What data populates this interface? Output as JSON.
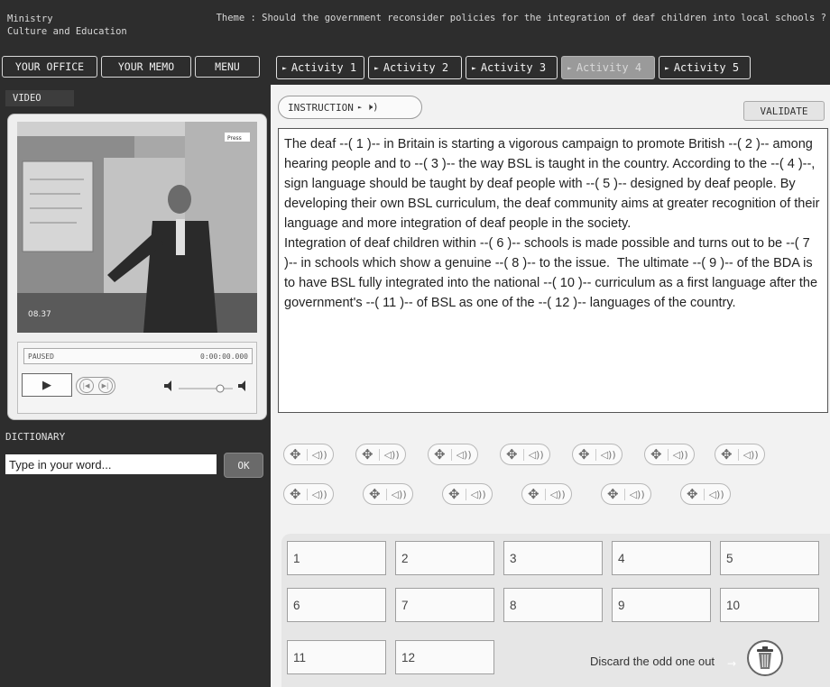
{
  "header": {
    "brand_line1": "Ministry",
    "brand_line2": "Culture and Education",
    "theme": "Theme : Should the government reconsider policies for the integration of deaf children into local schools ?"
  },
  "nav": {
    "office": "YOUR OFFICE",
    "memo": "YOUR MEMO",
    "menu": "MENU",
    "activities": [
      "Activity 1",
      "Activity 2",
      "Activity 3",
      "Activity 4",
      "Activity 5"
    ],
    "active_activity": "Activity 4"
  },
  "video": {
    "label": "VIDEO",
    "status": "PAUSED",
    "time": "0:00:00.000",
    "timestamp_overlay": "08.37",
    "corner_tag": "Press"
  },
  "dictionary": {
    "label": "DICTIONARY",
    "placeholder": "Type in your word...",
    "ok": "OK"
  },
  "main": {
    "instruction": "INSTRUCTION",
    "validate": "VALIDATE",
    "text": "The deaf --( 1 )-- in Britain is starting a vigorous campaign to promote British --( 2 )-- among hearing people and to --( 3 )-- the way BSL is taught in the country. According to the --( 4 )--, sign language should be taught by deaf people with --( 5 )-- designed by deaf people. By developing their own BSL curriculum, the deaf community aims at greater recognition of their language and more integration of deaf people in the society.\nIntegration of deaf children within --( 6 )-- schools is made possible and turns out to be --( 7 )-- in schools which show a genuine --( 8 )-- to the issue.  The ultimate --( 9 )-- of the BDA is to have BSL fully integrated into the national --( 10 )-- curriculum as a first language after the government's --( 11 )-- of BSL as one of the --( 12 )-- languages of the country.",
    "chip_count": 13,
    "slots": [
      "1",
      "2",
      "3",
      "4",
      "5",
      "6",
      "7",
      "8",
      "9",
      "10",
      "11",
      "12"
    ],
    "discard": "Discard the odd one out"
  },
  "colors": {
    "background": "#2d2d2d",
    "panel": "#f2f2f2",
    "active_tab": "#9a9a9a"
  },
  "icons": [
    "move-icon",
    "speaker-icon",
    "play-icon",
    "volume-icon",
    "trash-icon"
  ]
}
